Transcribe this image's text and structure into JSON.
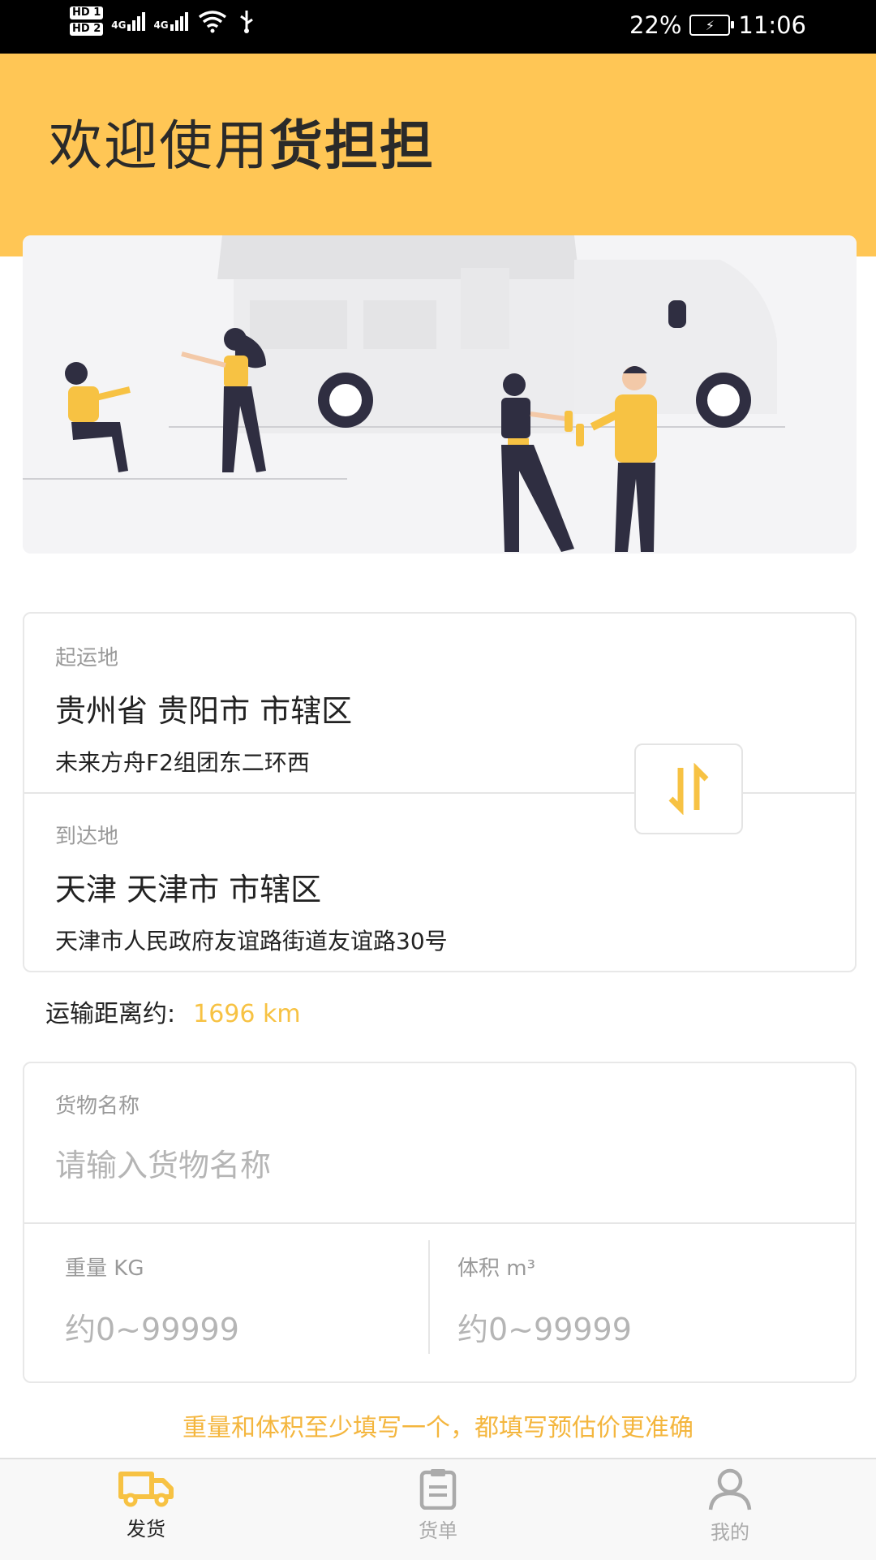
{
  "status_bar": {
    "hd1": "HD 1",
    "hd2": "HD 2",
    "network1": "4G",
    "network2": "4G",
    "battery": "22%",
    "time": "11:06"
  },
  "header": {
    "welcome": "欢迎使用",
    "app_name": "货担担"
  },
  "route": {
    "origin_label": "起运地",
    "origin_city": "贵州省 贵阳市 市辖区",
    "origin_address": "未来方舟F2组团东二环西",
    "dest_label": "到达地",
    "dest_city": "天津 天津市 市辖区",
    "dest_address": "天津市人民政府友谊路街道友谊路30号"
  },
  "distance": {
    "label": "运输距离约:",
    "value": "1696 km"
  },
  "cargo": {
    "name_label": "货物名称",
    "name_placeholder": "请输入货物名称",
    "weight_label": "重量 KG",
    "weight_placeholder": "约0~99999",
    "volume_label": "体积 m³",
    "volume_placeholder": "约0~99999"
  },
  "hint": "重量和体积至少填写一个，都填写预估价更准确",
  "tabs": [
    {
      "label": "发货",
      "icon": "truck-icon",
      "active": true
    },
    {
      "label": "货单",
      "icon": "clipboard-icon",
      "active": false
    },
    {
      "label": "我的",
      "icon": "person-icon",
      "active": false
    }
  ],
  "colors": {
    "accent": "#FFC655",
    "accent_text": "#F7C243",
    "tab_active": "#F7C243",
    "tab_inactive": "#aaaaaa"
  }
}
